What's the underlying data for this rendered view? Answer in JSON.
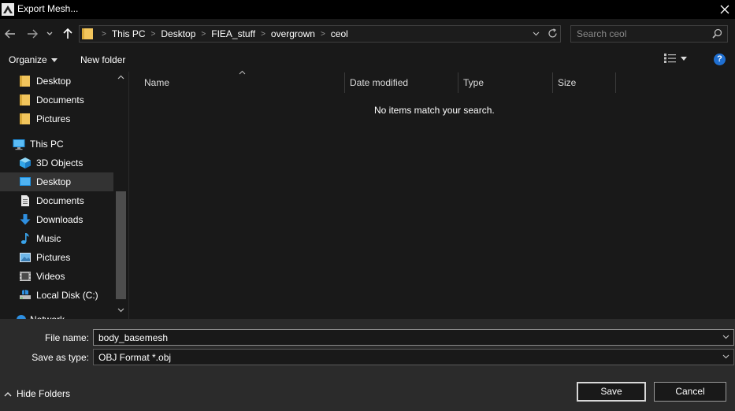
{
  "window": {
    "title": "Export Mesh..."
  },
  "address": {
    "breadcrumbs": [
      "This PC",
      "Desktop",
      "FIEA_stuff",
      "overgrown",
      "ceol"
    ]
  },
  "search": {
    "placeholder": "Search ceol",
    "value": ""
  },
  "commandbar": {
    "organize_label": "Organize",
    "new_folder_label": "New folder"
  },
  "navpane": {
    "quick_access": [
      {
        "label": "Desktop",
        "icon": "folder-icon"
      },
      {
        "label": "Documents",
        "icon": "folder-icon"
      },
      {
        "label": "Pictures",
        "icon": "folder-icon"
      }
    ],
    "this_pc_label": "This PC",
    "this_pc_items": [
      {
        "label": "3D Objects",
        "icon": "cube-icon"
      },
      {
        "label": "Desktop",
        "icon": "desktop-icon",
        "selected": true
      },
      {
        "label": "Documents",
        "icon": "document-icon"
      },
      {
        "label": "Downloads",
        "icon": "download-icon"
      },
      {
        "label": "Music",
        "icon": "music-icon"
      },
      {
        "label": "Pictures",
        "icon": "picture-icon"
      },
      {
        "label": "Videos",
        "icon": "video-icon"
      },
      {
        "label": "Local Disk (C:)",
        "icon": "disk-icon"
      }
    ],
    "network_label": "Network"
  },
  "filelist": {
    "columns": [
      "Name",
      "Date modified",
      "Type",
      "Size"
    ],
    "empty_message": "No items match your search."
  },
  "form": {
    "file_name_label": "File name:",
    "file_name_value": "body_basemesh",
    "save_type_label": "Save as type:",
    "save_type_value": "OBJ Format *.obj"
  },
  "footer": {
    "hide_folders_label": "Hide Folders",
    "save_label": "Save",
    "cancel_label": "Cancel"
  },
  "colors": {
    "background": "#191919",
    "bottom_panel": "#2b2b2b",
    "folder": "#f2c55c",
    "accent": "#1f6fd1"
  }
}
